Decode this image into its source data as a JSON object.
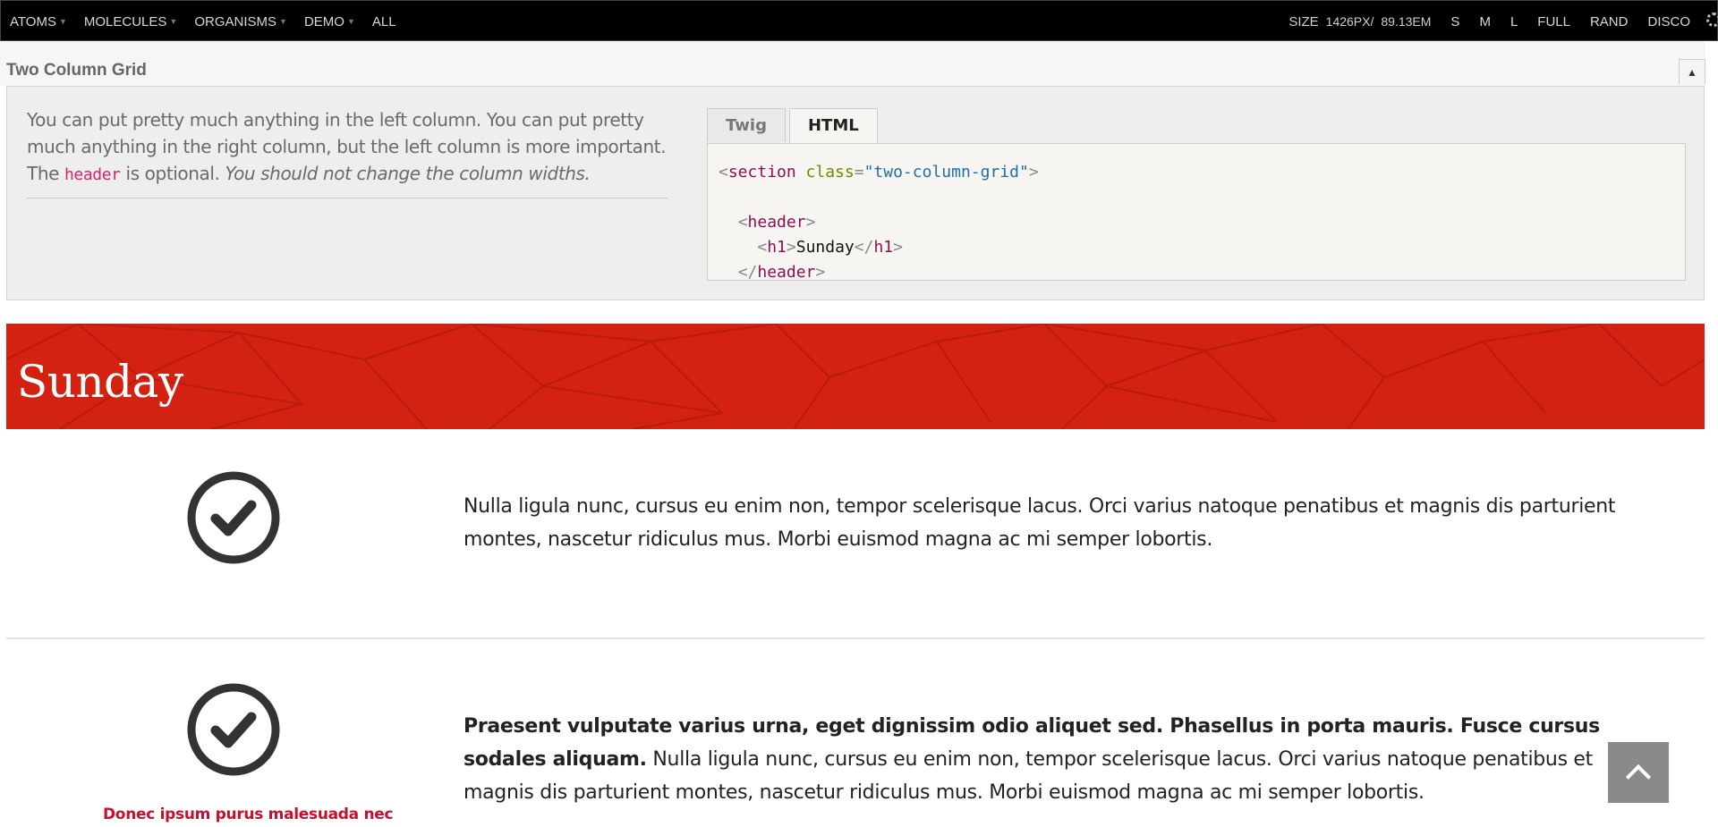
{
  "toolbar": {
    "nav": [
      {
        "label": "ATOMS",
        "has_caret": true
      },
      {
        "label": "MOLECULES",
        "has_caret": true
      },
      {
        "label": "ORGANISMS",
        "has_caret": true
      },
      {
        "label": "DEMO",
        "has_caret": true
      },
      {
        "label": "ALL",
        "has_caret": false
      }
    ],
    "size_label": "SIZE",
    "size_px": "1426PX",
    "size_sep": "/",
    "size_em": "89.13EM",
    "viewport_buttons": [
      "S",
      "M",
      "L",
      "FULL",
      "RAND",
      "DISCO"
    ],
    "settings_icon": "gear-icon"
  },
  "pattern": {
    "title": "Two Column Grid",
    "collapse_icon": "triangle-up-icon",
    "collapse_glyph": "▲",
    "description": {
      "part1": "You can put pretty much anything in the left column. You can put pretty much anything in the right column, but the left column is more important. The ",
      "code": "header",
      "part2": " is optional. ",
      "italic": "You should not change the column widths."
    },
    "tabs": [
      {
        "label": "Twig",
        "active": false
      },
      {
        "label": "HTML",
        "active": true
      }
    ],
    "code_lines": [
      {
        "indent": "",
        "open": "<",
        "tag": "section",
        "attr": " class",
        "eq": "=",
        "val": "\"two-column-grid\"",
        "close": ">",
        "text": ""
      },
      {
        "indent": "",
        "open": "",
        "tag": "",
        "attr": "",
        "eq": "",
        "val": "",
        "close": "",
        "text": ""
      },
      {
        "indent": "  ",
        "open": "<",
        "tag": "header",
        "attr": "",
        "eq": "",
        "val": "",
        "close": ">",
        "text": ""
      },
      {
        "indent": "    ",
        "open": "<",
        "tag": "h1",
        "attr": "",
        "eq": "",
        "val": "",
        "close": ">",
        "text": "Sunday",
        "tail_open": "</",
        "tail_tag": "h1",
        "tail_close": ">"
      },
      {
        "indent": "  ",
        "open": "</",
        "tag": "header",
        "attr": "",
        "eq": "",
        "val": "",
        "close": ">",
        "text": ""
      }
    ]
  },
  "demo": {
    "heading": "Sunday",
    "hero_color": "#d42212",
    "rows": [
      {
        "icon": "check-circle-icon",
        "bold": "",
        "text": "Nulla ligula nunc, cursus eu enim non, tempor scelerisque lacus. Orci varius natoque penatibus et magnis dis parturient montes, nascetur ridiculus mus. Morbi euismod magna ac mi semper lobortis."
      },
      {
        "icon": "check-circle-icon",
        "bold": "Praesent vulputate varius urna, eget dignissim odio aliquet sed. Phasellus in porta mauris. Fusce cursus sodales aliquam.",
        "text": "Nulla ligula nunc, cursus eu enim non, tempor scelerisque lacus. Orci varius natoque penatibus et magnis dis parturient montes, nascetur ridiculus mus. Morbi euismod magna ac mi semper lobortis.",
        "caption": "Donec ipsum purus malesuada nec"
      }
    ],
    "back_to_top_icon": "chevron-up-icon"
  }
}
